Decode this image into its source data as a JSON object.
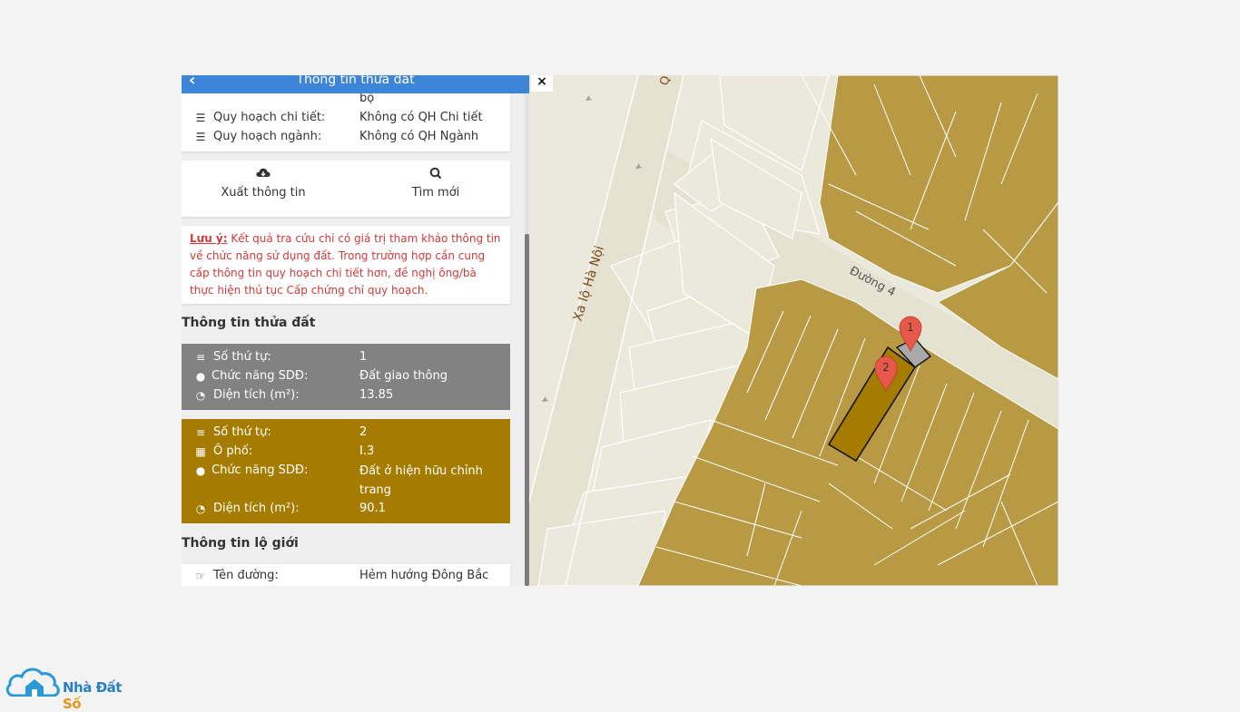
{
  "panel": {
    "title": "Thông tin thửa đất",
    "back_icon": "chevron-left-icon",
    "close_label": "×"
  },
  "planning": {
    "truncated_value": "bộ",
    "rows": [
      {
        "label": "Quy hoạch chi tiết:",
        "value": "Không có QH Chi tiết",
        "icon": "list-icon"
      },
      {
        "label": "Quy hoạch ngành:",
        "value": "Không có QH Ngành",
        "icon": "list-icon"
      }
    ]
  },
  "actions": {
    "export_label": "Xuất thông tin",
    "new_search_label": "Tìm mới"
  },
  "note": {
    "prefix": "Lưu ý:",
    "text": " Kết quả tra cứu chỉ có giá trị tham khảo thông tin về chức năng sử dụng đất. Trong trường hợp cần cung cấp thông tin quy hoạch chi tiết hơn, đề nghị ông/bà thực hiện thủ tục Cấp chứng chỉ quy hoạch."
  },
  "parcel_section_title": "Thông tin thửa đất",
  "parcels": [
    {
      "color": "#828282",
      "rows": [
        {
          "label": "Số thứ tự:",
          "value": "1"
        },
        {
          "label": "Chức năng SDĐ:",
          "value": "Đất giao thông"
        },
        {
          "label": "Diện tích (m²):",
          "value": "13.85"
        }
      ]
    },
    {
      "color": "#a57c00",
      "rows": [
        {
          "label": "Số thứ tự:",
          "value": "2"
        },
        {
          "label": "Ô phố:",
          "value": "I.3"
        },
        {
          "label": "Chức năng SDĐ:",
          "value": "Đất ở hiện hữu chỉnh trang"
        },
        {
          "label": "Diện tích (m²):",
          "value": "90.1"
        }
      ]
    }
  ],
  "boundary_section_title": "Thông tin lộ giới",
  "boundary": {
    "label": "Tên đường:",
    "value": "Hẻm hướng Đông Bắc"
  },
  "map": {
    "street_labels": [
      "Xa lộ Hà Nội",
      "Đường 4",
      "Q"
    ],
    "markers": [
      "1",
      "2"
    ],
    "colors": {
      "residential": "#b89a45",
      "road": "#e8e4d4",
      "background": "#ebe8dc",
      "selected_outline": "#111111",
      "marker": "#e8584a"
    }
  },
  "logo": {
    "name_part1": "Nhà Đất ",
    "name_part2": "Số"
  }
}
